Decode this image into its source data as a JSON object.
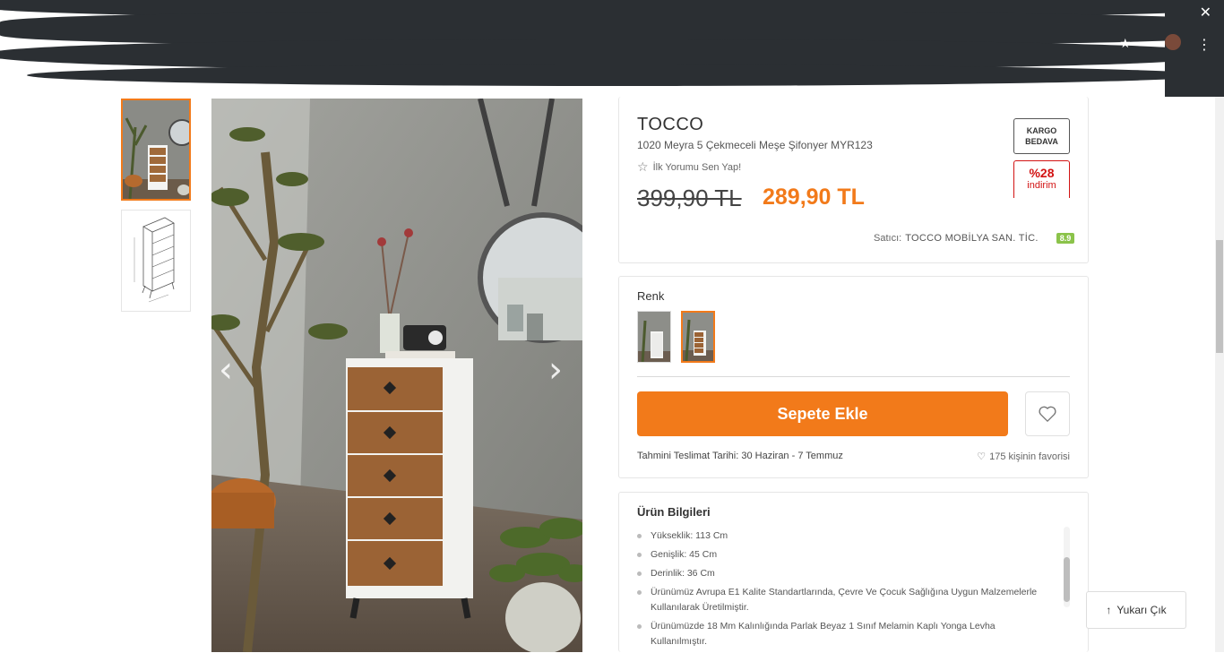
{
  "product": {
    "brand": "TOCCO",
    "name": "1020 Meyra 5 Çekmeceli Meşe Şifonyer MYR123",
    "review_prompt": "İlk Yorumu Sen Yap!",
    "old_price": "399,90 TL",
    "new_price": "289,90 TL",
    "badge_cargo": "KARGO BEDAVA",
    "badge_discount_pct": "%28",
    "badge_discount_label": "indirim",
    "seller_label": "Satıcı:",
    "seller_name": "TOCCO MOBİLYA SAN. TİC.",
    "seller_score": "8.9"
  },
  "variant": {
    "label": "Renk",
    "add_to_cart": "Sepete Ekle",
    "delivery": "Tahmini Teslimat Tarihi: 30 Haziran - 7 Temmuz",
    "fav_count": "175 kişinin favorisi"
  },
  "info": {
    "title": "Ürün Bilgileri",
    "items": [
      "Yükseklik: 113 Cm",
      "Genişlik: 45 Cm",
      "Derinlik: 36 Cm",
      "Ürünümüz Avrupa E1 Kalite Standartlarında, Çevre Ve Çocuk Sağlığına Uygun Malzemelerle Kullanılarak Üretilmiştir.",
      "Ürünümüzde 18 Mm Kalınlığında Parlak Beyaz 1 Sınıf Melamin Kaplı Yonga Levha Kullanılmıştır."
    ]
  },
  "scroll_top": "Yukarı Çık",
  "colors": {
    "accent": "#f27a1a",
    "discount": "#d21313",
    "seller_score": "#8bc34a"
  }
}
